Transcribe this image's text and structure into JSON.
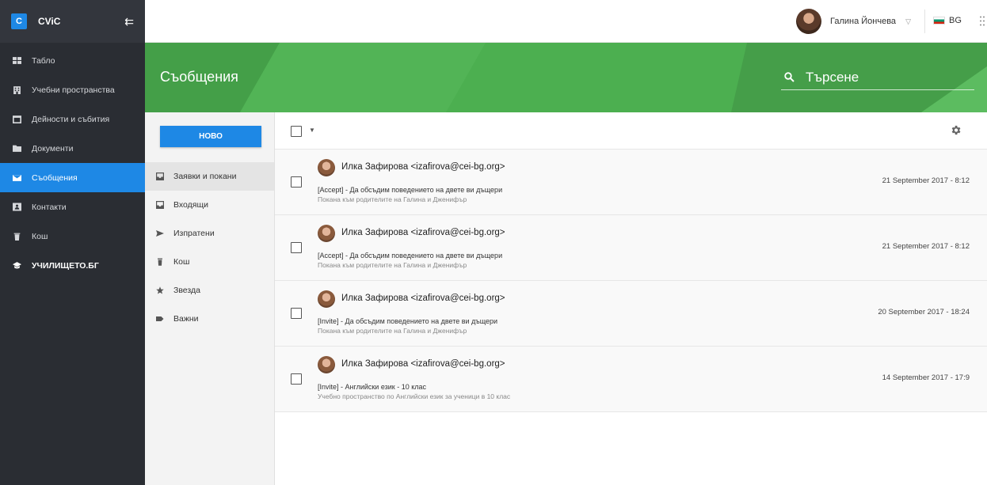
{
  "app": {
    "logo_letter": "C",
    "brand": "CViC"
  },
  "sidebar": {
    "items": [
      {
        "label": "Табло",
        "icon": "dashboard-icon"
      },
      {
        "label": "Учебни пространства",
        "icon": "building-icon"
      },
      {
        "label": "Дейности и събития",
        "icon": "calendar-icon"
      },
      {
        "label": "Документи",
        "icon": "folder-icon"
      },
      {
        "label": "Съобщения",
        "icon": "mail-icon",
        "active": true
      },
      {
        "label": "Контакти",
        "icon": "contact-card-icon"
      },
      {
        "label": "Кош",
        "icon": "trash-icon"
      },
      {
        "label": "УЧИЛИЩЕТО.БГ",
        "icon": "graduation-cap-icon"
      }
    ]
  },
  "header": {
    "user_name": "Галина Йончева",
    "language": "BG"
  },
  "banner": {
    "title": "Съобщения",
    "search_placeholder": "Търсене"
  },
  "folders": {
    "new_label": "НОВО",
    "items": [
      {
        "label": "Заявки и покани",
        "icon": "inbox-icon",
        "active": true
      },
      {
        "label": "Входящи",
        "icon": "inbox-icon"
      },
      {
        "label": "Изпратени",
        "icon": "send-icon"
      },
      {
        "label": "Кош",
        "icon": "trash-icon"
      },
      {
        "label": "Звезда",
        "icon": "star-icon"
      },
      {
        "label": "Важни",
        "icon": "label-icon"
      }
    ]
  },
  "messages": [
    {
      "from": "Илка Зафирова <izafirova@cei-bg.org>",
      "subject": "[Accept] - Да обсъдим поведението на двете ви дъщери",
      "preview": "Покана към родителите на Галина и Дженифър",
      "date": "21 September 2017 - 8:12"
    },
    {
      "from": "Илка Зафирова <izafirova@cei-bg.org>",
      "subject": "[Accept] - Да обсъдим поведението на двете ви дъщери",
      "preview": "Покана към родителите на Галина и Дженифър",
      "date": "21 September 2017 - 8:12"
    },
    {
      "from": "Илка Зафирова <izafirova@cei-bg.org>",
      "subject": "[Invite] - Да обсъдим поведението на двете ви дъщери",
      "preview": "Покана към родителите на Галина и Дженифър",
      "date": "20 September 2017 - 18:24"
    },
    {
      "from": "Илка Зафирова <izafirova@cei-bg.org>",
      "subject": "[Invite] - Английски език - 10 клас",
      "preview": "Учебно пространство по Английски език за ученици в 10 клас",
      "date": "14 September 2017 - 17:9"
    }
  ],
  "colors": {
    "accent": "#1e88e5",
    "banner": "#4caf50",
    "sidebar": "#2a2d33"
  }
}
